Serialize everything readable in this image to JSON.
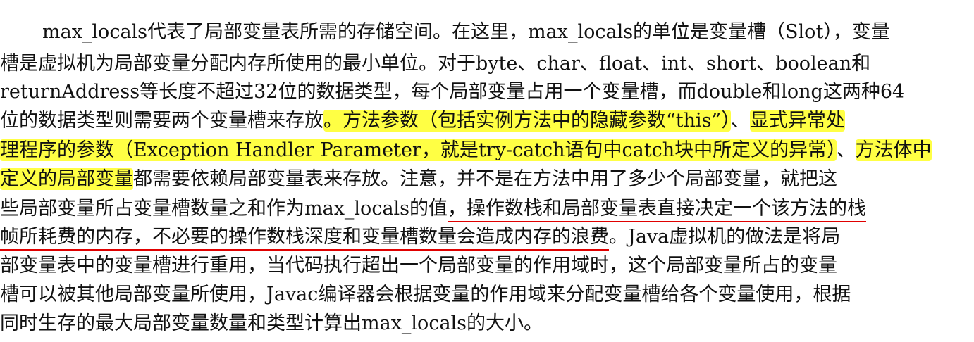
{
  "document": {
    "lines": [
      {
        "segments": [
          {
            "text": "max_locals代表了局部变量表所需的存储空间。在这里，max_locals的单位是变量槽（Slot），变量",
            "style": "normal"
          }
        ]
      },
      {
        "segments": [
          {
            "text": "槽是虚拟机为局部变量分配内存所使用的最小单位。对于byte、char、float、int、short、boolean和",
            "style": "normal"
          }
        ]
      },
      {
        "segments": [
          {
            "text": "returnAddress等长度不超过32位的数据类型，每个局部变量占用一个变量槽，而double和long这两种64",
            "style": "normal"
          }
        ]
      },
      {
        "segments": [
          {
            "text": "位的数据类型则需要两个变量槽来存放",
            "style": "normal"
          },
          {
            "text": "。方法参数（包括实例方法中的隐藏参数“this”）",
            "style": "highlight"
          },
          {
            "text": "、",
            "style": "normal"
          },
          {
            "text": "显式异常处",
            "style": "highlight"
          }
        ]
      },
      {
        "segments": [
          {
            "text": "理程序的参数（Exception Handler Parameter，就是try-catch语句中catch块中所定义的异常）",
            "style": "highlight"
          },
          {
            "text": "、",
            "style": "normal"
          },
          {
            "text": "方法体中",
            "style": "highlight"
          }
        ]
      },
      {
        "segments": [
          {
            "text": "定义的局部变量",
            "style": "highlight"
          },
          {
            "text": "都需要依赖局部变量表来存放。注意，并不是在方法中用了多少个局部变量，就把这",
            "style": "normal"
          }
        ]
      },
      {
        "segments": [
          {
            "text": "些局部变量所占变量槽数量之和作为max_locals的值",
            "style": "normal"
          },
          {
            "text": "，操作数栈和局部变量表直接决定一个该方法的栈",
            "style": "underline"
          }
        ]
      },
      {
        "segments": [
          {
            "text": "帧所耗费的内存，不必要的操作数栈深度和变量槽数量会造成内存的浪费",
            "style": "underline"
          },
          {
            "text": "。Java虚拟机的做法是将局",
            "style": "normal"
          }
        ]
      },
      {
        "segments": [
          {
            "text": "部变量表中的变量槽进行重用，当代码执行超出一个局部变量的作用域时，这个局部变量所占的变量",
            "style": "normal"
          }
        ]
      },
      {
        "segments": [
          {
            "text": "槽可以被其他局部变量所使用，Javac编译器会根据变量的作用域来分配变量槽给各个变量使用，根据",
            "style": "normal"
          }
        ]
      },
      {
        "segments": [
          {
            "text": "同时生存的最大局部变量数量和类型计算出max_locals的大小。",
            "style": "normal"
          }
        ]
      }
    ]
  }
}
